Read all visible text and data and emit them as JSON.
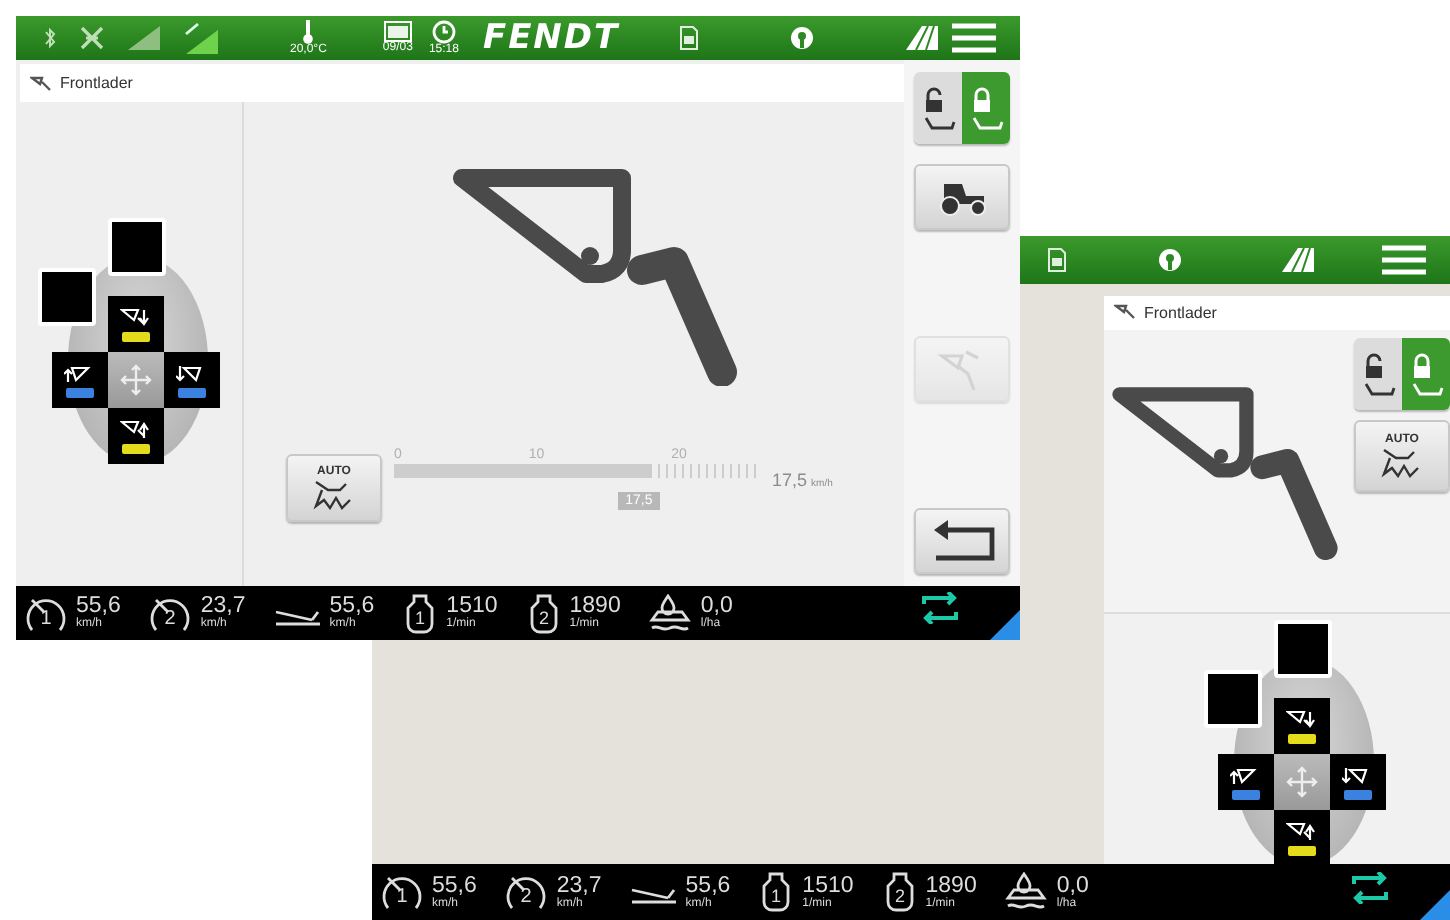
{
  "front_screen": {
    "top_bar": {
      "temperature": "20,0°C",
      "date": "09/03",
      "time": "15:18",
      "logo": "FENDT"
    },
    "panel": {
      "title": "Frontlader"
    },
    "lock_toggle": [
      {
        "kind": "unlocked",
        "selected": false
      },
      {
        "kind": "locked",
        "selected": true
      }
    ],
    "side_buttons": [
      {
        "kind": "tractor",
        "disabled": false
      },
      {
        "kind": "tip",
        "disabled": true
      },
      {
        "kind": "back",
        "disabled": false
      }
    ],
    "auto_button": {
      "label": "AUTO"
    },
    "speed_slider": {
      "ticks": [
        "0",
        "10",
        "20"
      ],
      "level": 0.7,
      "value": "17,5",
      "reading": "17,5",
      "unit": "km/h"
    },
    "joystick": [
      {
        "kind": "up",
        "color": "#e4dc1a"
      },
      {
        "kind": "left",
        "color": "#3b82e0"
      },
      {
        "kind": "right",
        "color": "#3b82e0"
      },
      {
        "kind": "down",
        "color": "#e4dc1a"
      }
    ],
    "bottom_bar": [
      {
        "kind": "speed",
        "number": "1",
        "value": "55,6",
        "unit": "km/h"
      },
      {
        "kind": "speed",
        "number": "2",
        "value": "23,7",
        "unit": "km/h"
      },
      {
        "kind": "pedal",
        "value": "55,6",
        "unit": "km/h"
      },
      {
        "kind": "engine",
        "number": "1",
        "value": "1510",
        "unit": "1/min"
      },
      {
        "kind": "engine",
        "number": "2",
        "value": "1890",
        "unit": "1/min"
      },
      {
        "kind": "fuel",
        "value": "0,0",
        "unit": "l/ha"
      }
    ]
  },
  "back_screen": {
    "panel": {
      "title": "Frontlader"
    },
    "lock_toggle": [
      {
        "kind": "unlocked",
        "selected": false
      },
      {
        "kind": "locked",
        "selected": true
      }
    ],
    "auto_button": {
      "label": "AUTO"
    },
    "joystick": [
      {
        "kind": "up",
        "color": "#e4dc1a"
      },
      {
        "kind": "left",
        "color": "#3b82e0"
      },
      {
        "kind": "right",
        "color": "#3b82e0"
      },
      {
        "kind": "down",
        "color": "#e4dc1a"
      }
    ],
    "bottom_bar": [
      {
        "kind": "speed",
        "number": "1",
        "value": "55,6",
        "unit": "km/h"
      },
      {
        "kind": "speed",
        "number": "2",
        "value": "23,7",
        "unit": "km/h"
      },
      {
        "kind": "pedal",
        "value": "55,6",
        "unit": "km/h"
      },
      {
        "kind": "engine",
        "number": "1",
        "value": "1510",
        "unit": "1/min"
      },
      {
        "kind": "engine",
        "number": "2",
        "value": "1890",
        "unit": "1/min"
      },
      {
        "kind": "fuel",
        "value": "0,0",
        "unit": "l/ha"
      }
    ]
  }
}
